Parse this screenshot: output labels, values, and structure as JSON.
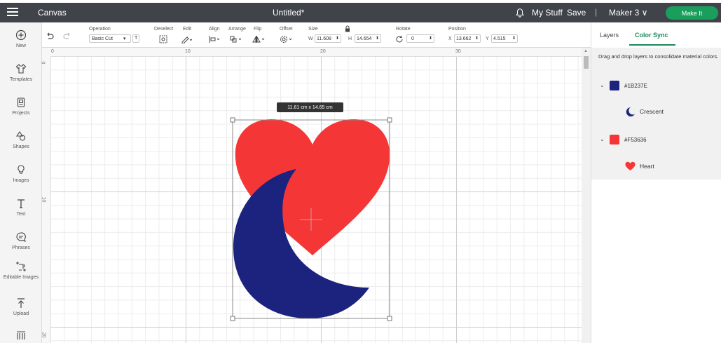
{
  "header": {
    "app_title": "Canvas",
    "doc_title": "Untitled*",
    "my_stuff": "My Stuff",
    "save": "Save",
    "separator": "|",
    "machine": "Maker 3 ∨",
    "make_it": "Make It"
  },
  "toolbar": {
    "operation_label": "Operation",
    "operation_value": "Basic Cut",
    "deselect_label": "Deselect",
    "edit_label": "Edit",
    "align_label": "Align",
    "arrange_label": "Arrange",
    "flip_label": "Flip",
    "offset_label": "Offset",
    "size_label": "Size",
    "w_label": "W",
    "w_value": "11.608",
    "h_label": "H",
    "h_value": "14.654",
    "rotate_label": "Rotate",
    "rotate_value": "0",
    "position_label": "Position",
    "x_label": "X",
    "x_value": "13.662",
    "y_label": "Y",
    "y_value": "4.515"
  },
  "sidenav": {
    "items": [
      {
        "label": "New",
        "icon": "plus-circle-icon"
      },
      {
        "label": "Templates",
        "icon": "shirt-icon"
      },
      {
        "label": "Projects",
        "icon": "projects-icon"
      },
      {
        "label": "Shapes",
        "icon": "shapes-icon"
      },
      {
        "label": "Images",
        "icon": "lightbulb-icon"
      },
      {
        "label": "Text",
        "icon": "text-icon"
      },
      {
        "label": "Phrases",
        "icon": "speech-bubble-icon"
      },
      {
        "label": "Editable Images",
        "icon": "editable-images-icon"
      },
      {
        "label": "Upload",
        "icon": "upload-icon"
      }
    ]
  },
  "rulers": {
    "h": [
      "0",
      "10",
      "20",
      "30"
    ],
    "v": [
      "0",
      "10",
      "20"
    ]
  },
  "canvas": {
    "size_tooltip": "11.61  cm x 14.65  cm"
  },
  "panel": {
    "tabs": [
      "Layers",
      "Color Sync"
    ],
    "active_tab": "Color Sync",
    "description": "Drag and drop layers to consolidate material colors.",
    "groups": [
      {
        "color": "#1B237E",
        "hex": "#1B237E",
        "item": "Crescent",
        "icon": "crescent-icon"
      },
      {
        "color": "#F53636",
        "hex": "#F53636",
        "item": "Heart",
        "icon": "heart-icon"
      }
    ]
  },
  "colors": {
    "topbar": "#40434a",
    "accent_green": "#1a9e5c",
    "heart": "#F53636",
    "crescent": "#1B237E"
  }
}
